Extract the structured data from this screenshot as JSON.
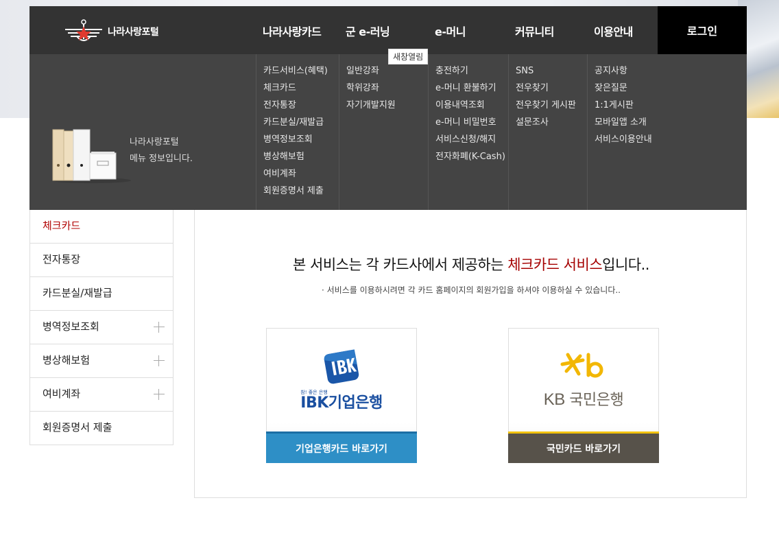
{
  "header": {
    "logo_text": "나라사랑포털",
    "nav": [
      "나라사랑카드",
      "군 e-러닝",
      "e-머니",
      "커뮤니티",
      "이용안내"
    ],
    "login_label": "로그인",
    "tooltip": "새창열림"
  },
  "megamenu": {
    "info_text_line1": "나라사랑포털",
    "info_text_line2": "메뉴 정보입니다.",
    "columns": [
      [
        "카드서비스(혜택)",
        "체크카드",
        "전자통장",
        "카드분실/재발급",
        "병역정보조회",
        "병상해보험",
        "여비계좌",
        "회원증명서 제출"
      ],
      [
        "일반강좌",
        "학위강좌",
        "자기개발지원"
      ],
      [
        "충전하기",
        "e-머니 환불하기",
        "이용내역조회",
        "e-머니 비밀번호",
        "서비스신청/해지",
        "전자화폐(K-Cash)"
      ],
      [
        "SNS",
        "전우찾기",
        "전우찾기 게시판",
        "설문조사"
      ],
      [
        "공지사항",
        "잦은질문",
        "1:1게시판",
        "모바일앱 소개",
        "서비스이용안내"
      ]
    ]
  },
  "sidebar": {
    "items": [
      {
        "label": "체크카드",
        "active": true,
        "expandable": false
      },
      {
        "label": "전자통장",
        "active": false,
        "expandable": false
      },
      {
        "label": "카드분실/재발급",
        "active": false,
        "expandable": false
      },
      {
        "label": "병역정보조회",
        "active": false,
        "expandable": true
      },
      {
        "label": "병상해보험",
        "active": false,
        "expandable": true
      },
      {
        "label": "여비계좌",
        "active": false,
        "expandable": true
      },
      {
        "label": "회원증명서 제출",
        "active": false,
        "expandable": false
      }
    ]
  },
  "main": {
    "headline_prefix": "본 서비스는 각 카드사에서 제공하는 ",
    "headline_highlight": "체크카드 서비스",
    "headline_suffix": "입니다..",
    "subline": "· 서비스를 이용하시려면 각 카드 홈페이지의 회원가입을 하셔야 이용하실 수 있습니다..",
    "cards": {
      "ibk": {
        "tagline": "참! 좋은 은행",
        "bank_name": "IBK기업은행",
        "button_label": "기업은행카드 바로가기"
      },
      "kb": {
        "bank_name_prefix": "KB",
        "bank_name": "국민은행",
        "button_label": "국민카드 바로가기"
      }
    }
  },
  "colors": {
    "active_red": "#b00000",
    "ibk_blue": "#2e8fc6",
    "kb_yellow": "#f2c20a",
    "kb_brown": "#57524a"
  }
}
